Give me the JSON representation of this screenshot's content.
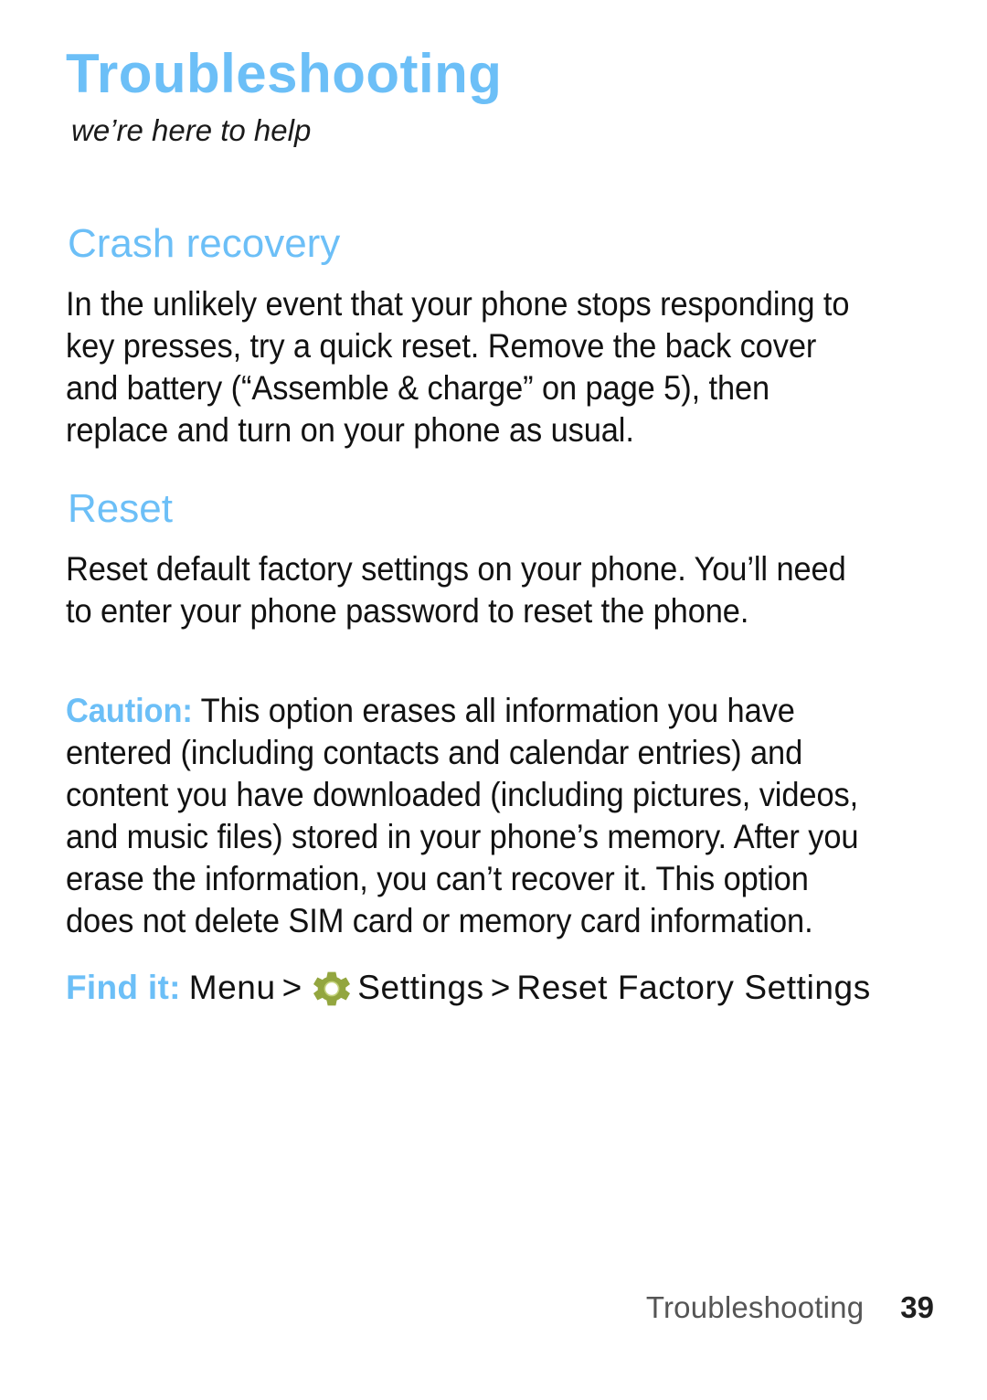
{
  "document": {
    "chapter_title": "Troubleshooting",
    "chapter_tagline": "we’re here to help",
    "accent_color": "#6CBFF7",
    "body_text_color": "#121212",
    "background_color": "#FFFFFF"
  },
  "sections": [
    {
      "heading": "Crash recovery",
      "body": "In the unlikely event that your phone stops responding to key presses, try a quick reset. Remove the back cover and battery (“Assemble & charge” on page 5), then replace and turn on your phone as usual."
    },
    {
      "heading": "Reset",
      "body": "Reset default factory settings on your phone. You’ll need to enter your phone password to reset the phone."
    }
  ],
  "caution": {
    "label": "Caution:",
    "text": " This option erases all information you have entered (including contacts and calendar entries) and content you have downloaded (including pictures, videos, and music files) stored in your phone’s memory. After you erase the information, you can’t recover it. This option does not delete SIM card or memory card information."
  },
  "find_it": {
    "label": "Find it:",
    "crumb_1": "Menu",
    "separator_1": ">",
    "icon": "gear-icon",
    "icon_color": "#8FA33C",
    "crumb_2": "Settings",
    "separator_2": ">",
    "crumb_3": "Reset Factory Settings"
  },
  "footer": {
    "chapter": "Troubleshooting",
    "page_number": "39"
  }
}
